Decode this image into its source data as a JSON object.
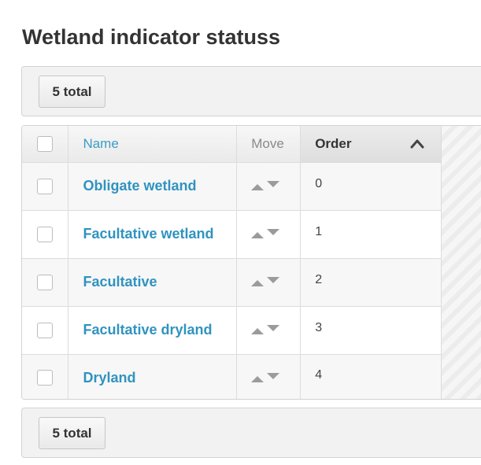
{
  "page": {
    "title": "Wetland indicator statuss"
  },
  "toolbar_top": {
    "total_label": "5 total"
  },
  "toolbar_bottom": {
    "total_label": "5 total"
  },
  "table": {
    "columns": {
      "name": "Name",
      "move": "Move",
      "order": "Order"
    },
    "sort": {
      "column": "Order",
      "direction": "ascending",
      "icon": "chevron-up-icon"
    },
    "rows": [
      {
        "name": "Obligate wetland",
        "order": "0"
      },
      {
        "name": "Facultative wetland",
        "order": "1"
      },
      {
        "name": "Facultative",
        "order": "2"
      },
      {
        "name": "Facultative dryland",
        "order": "3"
      },
      {
        "name": "Dryland",
        "order": "4"
      }
    ]
  },
  "colors": {
    "link": "#2f93bf",
    "title": "#333333",
    "toolbar_bg": "#f2f2f2"
  }
}
